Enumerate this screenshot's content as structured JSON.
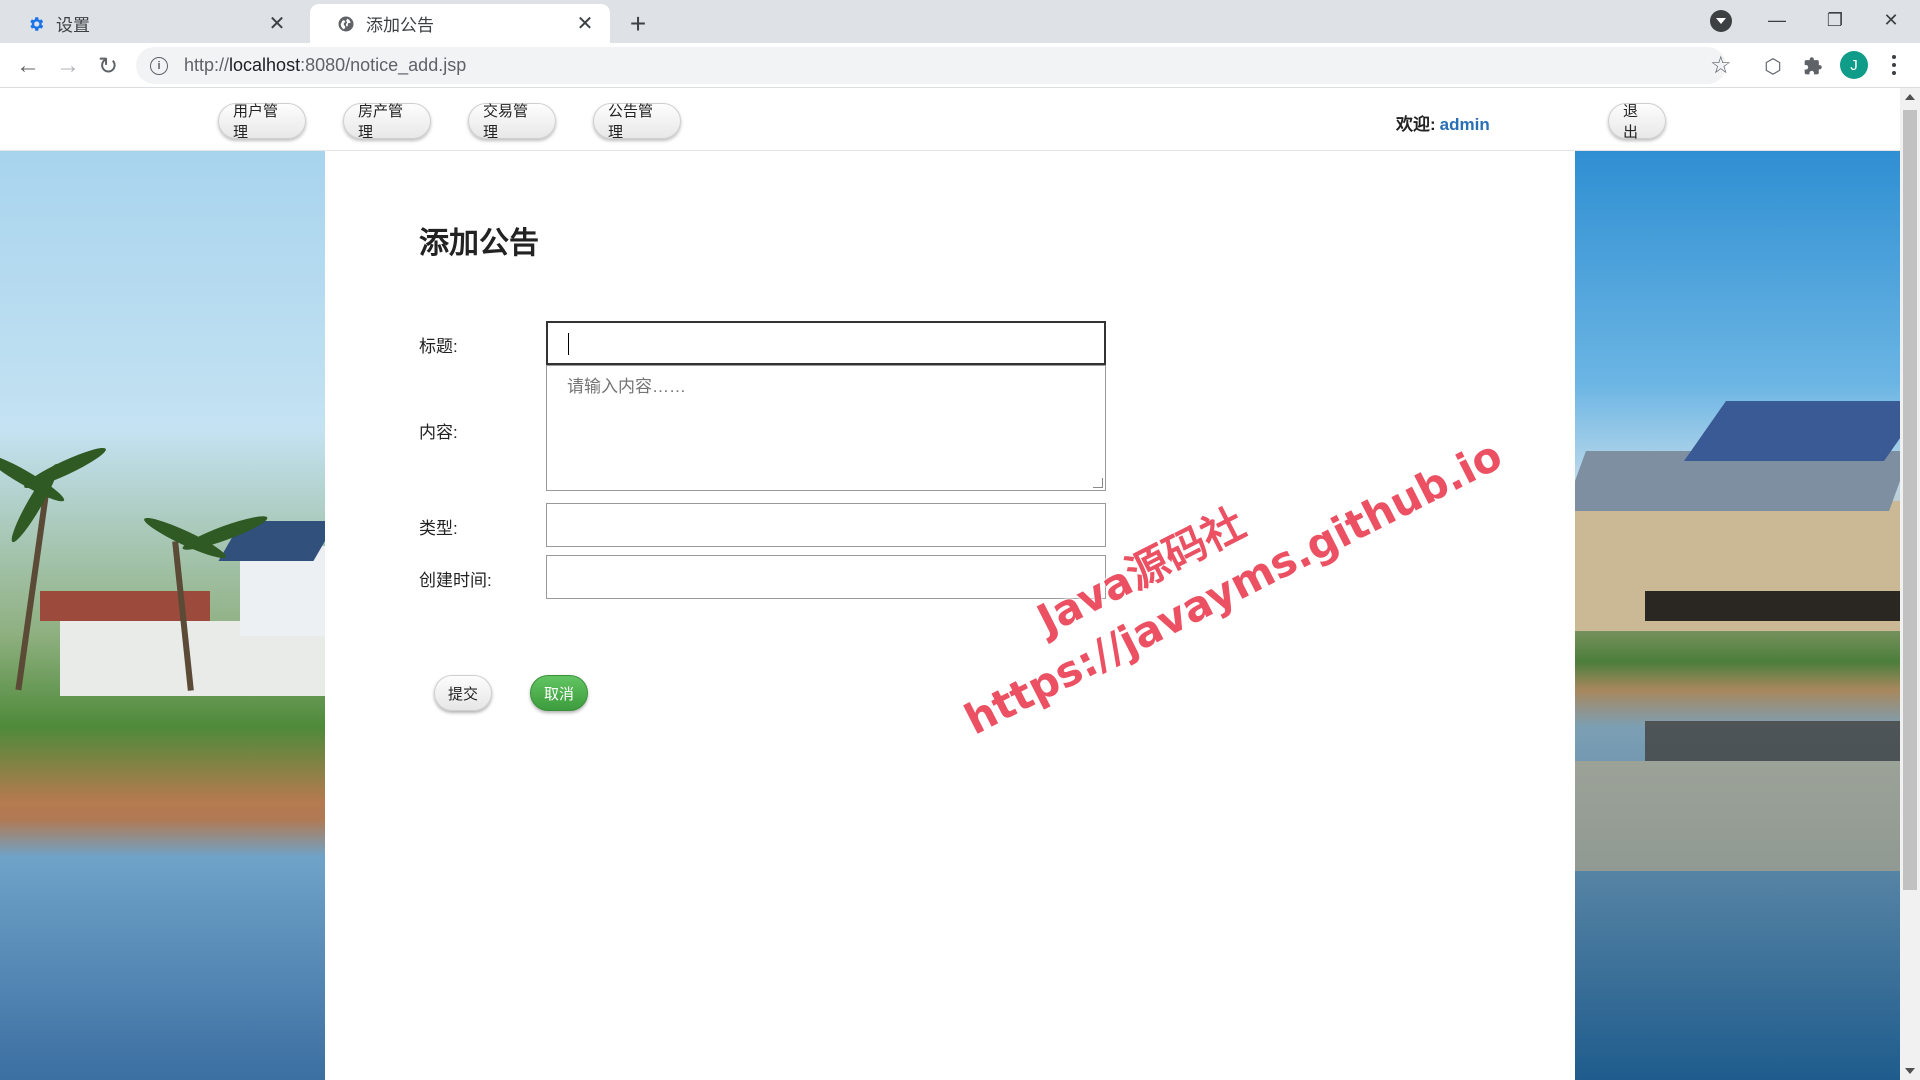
{
  "browser": {
    "tabs": [
      {
        "title": "设置",
        "icon": "gear-icon",
        "active": false
      },
      {
        "title": "添加公告",
        "icon": "globe-icon",
        "active": true
      }
    ],
    "url": {
      "scheme": "http://",
      "host": "localhost",
      "rest": ":8080/notice_add.jsp"
    },
    "profile_initial": "J"
  },
  "site": {
    "nav": [
      "用户管理",
      "房产管理",
      "交易管理",
      "公告管理"
    ],
    "welcome_label": "欢迎:",
    "username": "admin",
    "logout_label": "退出"
  },
  "form": {
    "heading": "添加公告",
    "title_label": "标题:",
    "title_value": "",
    "content_label": "内容:",
    "content_placeholder": "请输入内容……",
    "type_label": "类型:",
    "type_value": "",
    "created_label": "创建时间:",
    "created_value": "",
    "submit_label": "提交",
    "cancel_label": "取消"
  },
  "watermark": {
    "line1": "Java源码社",
    "line2": "https://javayms.github.io"
  },
  "colors": {
    "accent_green": "#4cae4c",
    "username_blue": "#2a6eb5",
    "watermark_red": "#e83246"
  }
}
